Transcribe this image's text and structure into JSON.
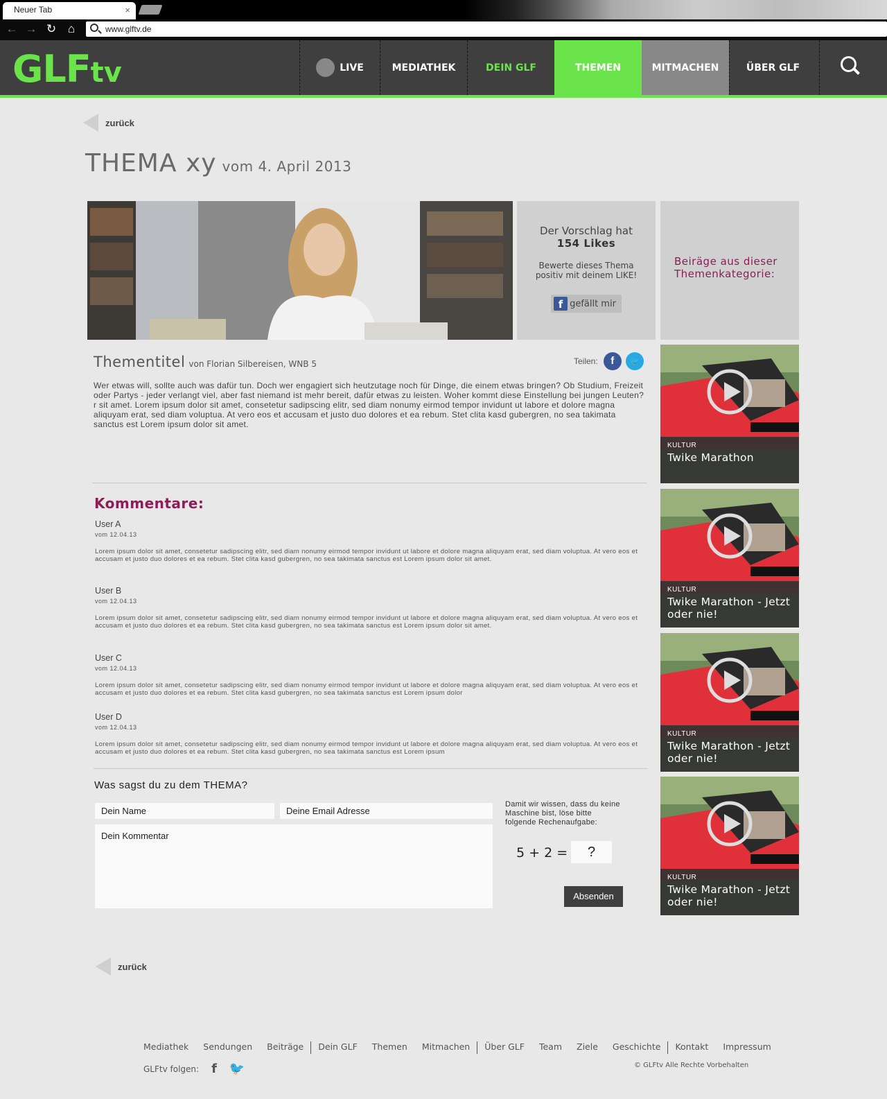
{
  "browser": {
    "tab_title": "Neuer Tab",
    "tab_close": "×",
    "url": "www.glftv.de"
  },
  "logo": {
    "main": "GLF",
    "suffix": "tv"
  },
  "nav": {
    "live": "LIVE",
    "mediathek": "MEDIATHEK",
    "dein_glf": "DEIN GLF",
    "themen": "THEMEN",
    "mitmachen": "MITMACHEN",
    "ueber_glf": "ÜBER GLF"
  },
  "back_label": "zurück",
  "title": {
    "main": "THEMA xy",
    "date": "vom 4. April 2013"
  },
  "like_box": {
    "line1": "Der Vorschlag hat",
    "likes": "154 Likes",
    "prompt": "Bewerte dieses Thema positiv mit deinem LIKE!",
    "button": "gefällt mir"
  },
  "category_box": {
    "label": "Beiräge aus dieser Themenkategorie:"
  },
  "article": {
    "title": "Thementitel",
    "byline": "von Florian Silbereisen, WNB 5",
    "share_label": "Teilen:",
    "body": "Wer etwas will, sollte auch was dafür tun. Doch wer engagiert sich heutzutage noch für Dinge, die einem etwas bringen? Ob Studium, Freizeit oder Partys - jeder verlangt viel, aber fast niemand ist mehr bereit, dafür etwas zu leisten. Woher kommt diese Einstellung bei jungen Leuten? r sit amet. Lorem ipsum dolor sit amet, consetetur sadipscing elitr, sed diam nonumy eirmod tempor invidunt ut labore et dolore magna aliquyam erat, sed diam voluptua. At vero eos et accusam et justo duo dolores et ea rebum. Stet clita kasd gubergren, no sea takimata sanctus est Lorem ipsum dolor sit amet."
  },
  "comments": {
    "heading": "Kommentare:",
    "items": [
      {
        "user": "User A",
        "date": "vom 12.04.13",
        "text": "Lorem ipsum dolor sit amet, consetetur sadipscing elitr, sed diam nonumy eirmod tempor invidunt ut labore et dolore magna aliquyam erat, sed diam voluptua. At vero eos et accusam et justo duo dolores et ea rebum. Stet clita kasd gubergren, no sea takimata sanctus est Lorem ipsum dolor sit amet."
      },
      {
        "user": "User B",
        "date": "vom 12.04.13",
        "text": "Lorem ipsum dolor sit amet, consetetur sadipscing elitr, sed diam nonumy eirmod tempor invidunt ut labore et dolore magna aliquyam erat, sed diam voluptua. At vero eos et accusam et justo duo dolores et ea rebum. Stet clita kasd gubergren, no sea takimata sanctus est Lorem ipsum dolor sit amet."
      },
      {
        "user": "User C",
        "date": "vom 12.04.13",
        "text": "Lorem ipsum dolor sit amet, consetetur sadipscing elitr, sed diam nonumy eirmod tempor invidunt ut labore et dolore magna aliquyam erat, sed diam voluptua. At vero eos et accusam et justo duo dolores et ea rebum. Stet clita kasd gubergren, no sea takimata sanctus est Lorem ipsum dolor"
      },
      {
        "user": "User D",
        "date": "vom 12.04.13",
        "text": "Lorem ipsum dolor sit amet, consetetur sadipscing elitr, sed diam nonumy eirmod tempor invidunt ut labore et dolore magna aliquyam erat, sed diam voluptua. At vero eos et accusam et justo duo dolores et ea rebum. Stet clita kasd gubergren, no sea takimata sanctus est Lorem ipsum"
      }
    ]
  },
  "form": {
    "question": "Was sagst du zu dem THEMA?",
    "name_placeholder": "Dein Name",
    "email_placeholder": "Deine Email Adresse",
    "comment_placeholder": "Dein Kommentar",
    "captcha_note": "Damit wir wissen, dass du keine Maschine bist, löse bitte folgende Rechenaufgabe:",
    "captcha_equation": "5 + 2 =",
    "captcha_answer": "?",
    "submit": "Absenden"
  },
  "videos": [
    {
      "category": "KULTUR",
      "title": "Twike Marathon"
    },
    {
      "category": "KULTUR",
      "title": "Twike Marathon - Jetzt oder nie!"
    },
    {
      "category": "KULTUR",
      "title": "Twike Marathon - Jetzt oder nie!"
    },
    {
      "category": "KULTUR",
      "title": "Twike Marathon - Jetzt oder nie!"
    }
  ],
  "footer": {
    "links": [
      "Mediathek",
      "Sendungen",
      "Beiträge",
      "Dein GLF",
      "Themen",
      "Mitmachen",
      "Über GLF",
      "Team",
      "Ziele",
      "Geschichte",
      "Kontakt",
      "Impressum"
    ],
    "follow_label": "GLFtv folgen:",
    "copyright": "© GLFtv Alle Rechte Vorbehalten"
  },
  "colors": {
    "brand_green": "#6be34a",
    "accent_magenta": "#8c1d56",
    "header_dark": "#3f3f3f"
  }
}
